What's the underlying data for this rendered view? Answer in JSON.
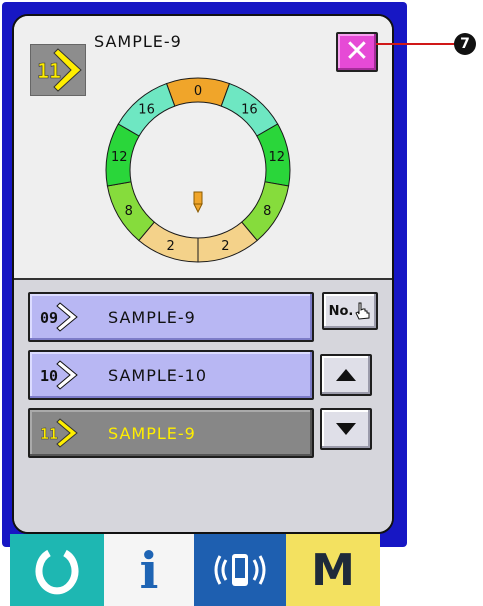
{
  "header": {
    "title": "SAMPLE-9",
    "pattern_no": "11"
  },
  "close_button": {
    "label": "✕"
  },
  "ring": {
    "segments": [
      {
        "label": "0",
        "color": "#f0a52a"
      },
      {
        "label": "16",
        "color": "#6ee7c2"
      },
      {
        "label": "12",
        "color": "#2ad63a"
      },
      {
        "label": "8",
        "color": "#86dc3c"
      },
      {
        "label": "2",
        "color": "#f4d28a"
      },
      {
        "label": "2",
        "color": "#f4d28a"
      },
      {
        "label": "8",
        "color": "#86dc3c"
      },
      {
        "label": "12",
        "color": "#2ad63a"
      },
      {
        "label": "16",
        "color": "#6ee7c2"
      }
    ]
  },
  "list": {
    "items": [
      {
        "num": "09",
        "name": "SAMPLE-9",
        "selected": false
      },
      {
        "num": "10",
        "name": "SAMPLE-10",
        "selected": false
      },
      {
        "num": "11",
        "name": "SAMPLE-9",
        "selected": true
      }
    ]
  },
  "side_buttons": {
    "no_label": "No."
  },
  "callout": {
    "number": "7"
  },
  "colors": {
    "screen_bg": "#1717c4",
    "item_bg": "#b8b7f3",
    "selected_bg": "#878787",
    "selected_text": "#ffee00"
  }
}
